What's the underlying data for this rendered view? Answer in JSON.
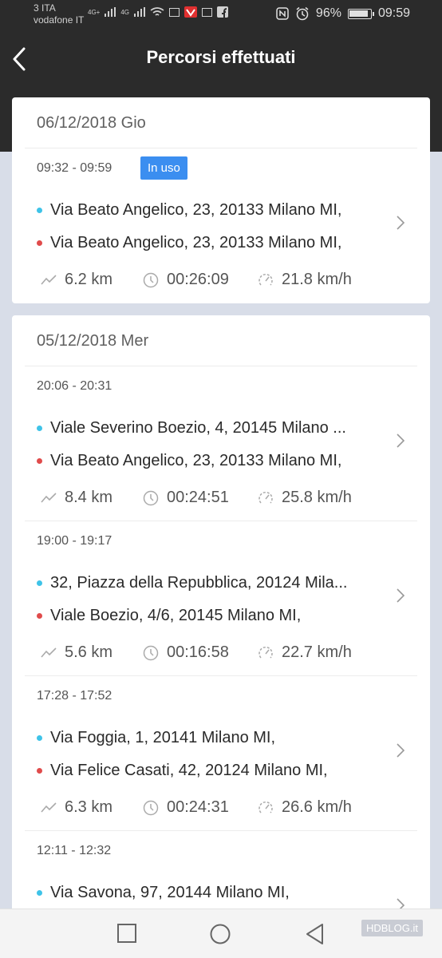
{
  "status_bar": {
    "carrier_top": "3 ITA",
    "carrier_bottom": "vodafone IT",
    "net1": "4G+",
    "net2": "4G",
    "battery_text": "96%",
    "time": "09:59"
  },
  "header": {
    "title": "Percorsi effettuati"
  },
  "days": [
    {
      "date": "06/12/2018 Gio",
      "trips": [
        {
          "time": "09:32 - 09:59",
          "badge": "In uso",
          "start": "Via Beato Angelico, 23, 20133 Milano MI,",
          "end": "Via Beato Angelico, 23, 20133 Milano MI,",
          "distance": "6.2 km",
          "duration": "00:26:09",
          "speed": "21.8 km/h"
        }
      ]
    },
    {
      "date": "05/12/2018 Mer",
      "trips": [
        {
          "time": "20:06 - 20:31",
          "start": "Viale Severino Boezio, 4, 20145 Milano ...",
          "end": "Via Beato Angelico, 23, 20133 Milano MI,",
          "distance": "8.4 km",
          "duration": "00:24:51",
          "speed": "25.8 km/h"
        },
        {
          "time": "19:00 - 19:17",
          "start": "32, Piazza della Repubblica, 20124 Mila...",
          "end": "Viale Boezio, 4/6, 20145 Milano MI,",
          "distance": "5.6 km",
          "duration": "00:16:58",
          "speed": "22.7 km/h"
        },
        {
          "time": "17:28 - 17:52",
          "start": "Via Foggia, 1, 20141 Milano MI,",
          "end": "Via Felice Casati, 42, 20124 Milano MI,",
          "distance": "6.3 km",
          "duration": "00:24:31",
          "speed": "26.6 km/h"
        },
        {
          "time": "12:11 - 12:32",
          "start": "Via Savona, 97, 20144 Milano MI,"
        }
      ]
    }
  ],
  "watermark": "HDBLOG.it",
  "colors": {
    "header_bg": "#2b2b2b",
    "page_bg": "#d8dde8",
    "badge": "#3b8ef0",
    "start_dot": "#3ec3e8",
    "end_dot": "#e04b4b"
  }
}
